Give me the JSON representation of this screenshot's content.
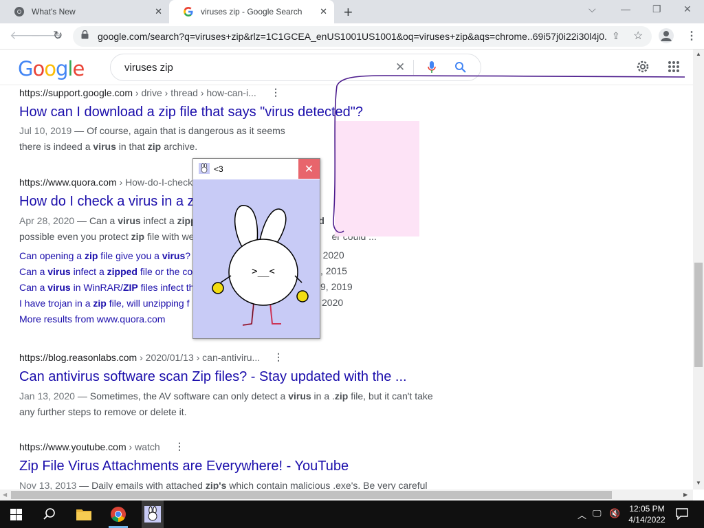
{
  "browser": {
    "tabs": [
      {
        "title": "What's New",
        "close": "✕"
      },
      {
        "title": "viruses zip - Google Search",
        "close": "✕"
      }
    ],
    "new_tab": "+",
    "url": "google.com/search?q=viruses+zip&rlz=1C1GCEA_enUS1001US1001&oq=viruses+zip&aqs=chrome..69i57j0i22i30l4j0..."
  },
  "google": {
    "logo": "Google",
    "search_value": "viruses zip"
  },
  "results": [
    {
      "site": "https://support.google.com",
      "path": " › drive › thread › how-can-i...",
      "title": "How can I download a zip file that says \"virus detected\"?",
      "date": "Jul 10, 2019",
      "snippet_line1": " — Of course, again that is dangerous as it seems",
      "snippet_line2_pre": "there is indeed a ",
      "snippet_line2_b1": "virus",
      "snippet_line2_mid": " in that ",
      "snippet_line2_b2": "zip",
      "snippet_line2_post": " archive."
    },
    {
      "site": "https://www.quora.com",
      "path": " › How-do-I-check",
      "title": "How do I check a virus in a z",
      "date": "Apr 28, 2020",
      "snippet_line1_a": " — Can a ",
      "snippet_line1_b": "virus",
      "snippet_line1_c": " infect a ",
      "snippet_line1_d": "zipp",
      "snippet_line1_e": "ed",
      "snippet_line2_a": "possible even you protect ",
      "snippet_line2_b": "zip",
      "snippet_line2_c": " file with we",
      "snippet_line2_d": "er could ...",
      "subs": [
        {
          "a": "Can opening a ",
          "b": "zip",
          "c": " file give you a ",
          "d": "virus",
          "e": "? -",
          "date": "0, 2020"
        },
        {
          "a": "Can a ",
          "b": "virus",
          "c": " infect a ",
          "d": "zipped",
          "e": " file or the con",
          "date": ", 2015"
        },
        {
          "a": "Can a ",
          "b": "virus",
          "c": " in WinRAR/",
          "d": "ZIP",
          "e": " files infect th",
          "date": "9, 2019"
        },
        {
          "a": "I have trojan in a ",
          "b": "zip",
          "c": " file, will unzipping f",
          "d": "",
          "e": "",
          "date": "2020"
        }
      ],
      "more": "More results from www.quora.com"
    },
    {
      "site": "https://blog.reasonlabs.com",
      "path": " › 2020/01/13 › can-antiviru...",
      "title": "Can antivirus software scan Zip files? - Stay updated with the ...",
      "date": "Jan 13, 2020",
      "snippet_a": " — Sometimes, the AV software can only detect a ",
      "snippet_b": "virus",
      "snippet_c": " in a .",
      "snippet_d": "zip",
      "snippet_e": " file, but it can't take",
      "snippet_line2": "any further steps to remove or delete it."
    },
    {
      "site": "https://www.youtube.com",
      "path": " › watch",
      "title": "Zip File Virus Attachments are Everywhere! - YouTube",
      "date": "Nov 13, 2013",
      "snippet_a": " — Daily emails with attached ",
      "snippet_b": "zip's",
      "snippet_c": " which contain malicious .exe's. Be very careful"
    }
  ],
  "popup": {
    "title": "<3",
    "close": "✕",
    "face": ">__<"
  },
  "taskbar": {
    "time": "12:05 PM",
    "date": "4/14/2022"
  },
  "colors": {
    "link": "#1a0dab",
    "popup_bg": "#c8cbf6",
    "popup_close": "#e8656c",
    "pink_overlay": "#fde3f6",
    "scribble": "#4b1a8c"
  }
}
